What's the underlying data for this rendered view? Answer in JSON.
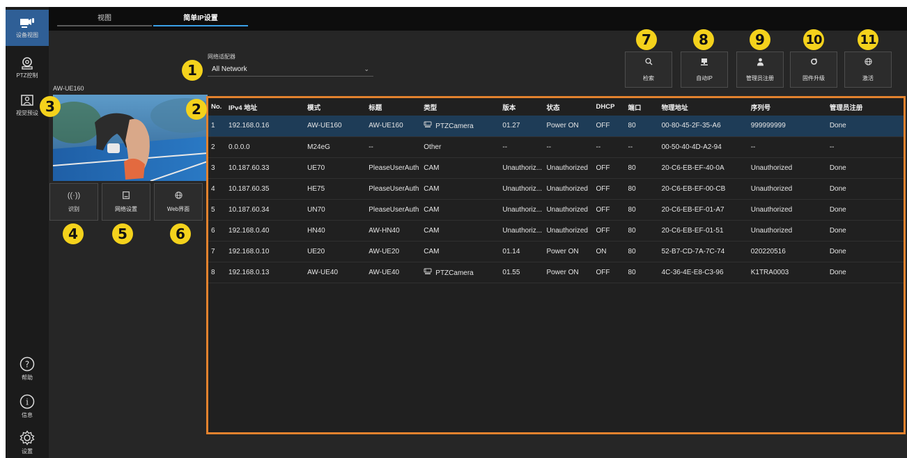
{
  "nav": {
    "items": [
      {
        "label": "设备视图",
        "icon": "camera-mic-icon"
      },
      {
        "label": "PTZ控制",
        "icon": "ptz-camera-icon"
      },
      {
        "label": "视觉预设",
        "icon": "person-frame-icon"
      },
      {
        "label": "帮助",
        "icon": "question-icon"
      },
      {
        "label": "信息",
        "icon": "info-icon"
      },
      {
        "label": "设置",
        "icon": "gear-icon"
      }
    ]
  },
  "tabs": [
    {
      "label": "视图",
      "active": false
    },
    {
      "label": "简单IP设置",
      "active": true
    }
  ],
  "adapter": {
    "label": "网络适配器",
    "value": "All Network"
  },
  "camera": {
    "name": "AW-UE160"
  },
  "camera_buttons": [
    {
      "label": "识别",
      "icon": "signal-icon"
    },
    {
      "label": "网络设置",
      "icon": "network-settings-icon"
    },
    {
      "label": "Web界面",
      "icon": "globe-icon"
    }
  ],
  "toolbar": [
    {
      "label": "检索",
      "icon": "search-icon"
    },
    {
      "label": "自动IP",
      "icon": "network-device-icon"
    },
    {
      "label": "管理员注册",
      "icon": "user-icon"
    },
    {
      "label": "固件升级",
      "icon": "refresh-icon"
    },
    {
      "label": "激活",
      "icon": "globe-icon"
    }
  ],
  "callouts": [
    "1",
    "2",
    "3",
    "4",
    "5",
    "6",
    "7",
    "8",
    "9",
    "10",
    "11"
  ],
  "table": {
    "headers": [
      "No.",
      "IPv4 地址",
      "模式",
      "标题",
      "类型",
      "版本",
      "状态",
      "DHCP",
      "端口",
      "物理地址",
      "序列号",
      "管理员注册"
    ],
    "rows": [
      [
        "1",
        "192.168.0.16",
        "AW-UE160",
        "AW-UE160",
        "PTZCamera",
        "01.27",
        "Power ON",
        "OFF",
        "80",
        "00-80-45-2F-35-A6",
        "999999999",
        "Done"
      ],
      [
        "2",
        "0.0.0.0",
        "M24eG",
        "--",
        "Other",
        "--",
        "--",
        "--",
        "--",
        "00-50-40-4D-A2-94",
        "--",
        "--"
      ],
      [
        "3",
        "10.187.60.33",
        "UE70",
        "PleaseUserAuth",
        "CAM",
        "Unauthoriz...",
        "Unauthorized",
        "OFF",
        "80",
        "20-C6-EB-EF-40-0A",
        "Unauthorized",
        "Done"
      ],
      [
        "4",
        "10.187.60.35",
        "HE75",
        "PleaseUserAuth",
        "CAM",
        "Unauthoriz...",
        "Unauthorized",
        "OFF",
        "80",
        "20-C6-EB-EF-00-CB",
        "Unauthorized",
        "Done"
      ],
      [
        "5",
        "10.187.60.34",
        "UN70",
        "PleaseUserAuth",
        "CAM",
        "Unauthoriz...",
        "Unauthorized",
        "OFF",
        "80",
        "20-C6-EB-EF-01-A7",
        "Unauthorized",
        "Done"
      ],
      [
        "6",
        "192.168.0.40",
        "HN40",
        "AW-HN40",
        "CAM",
        "Unauthoriz...",
        "Unauthorized",
        "OFF",
        "80",
        "20-C6-EB-EF-01-51",
        "Unauthorized",
        "Done"
      ],
      [
        "7",
        "192.168.0.10",
        "UE20",
        "AW-UE20",
        "CAM",
        "01.14",
        "Power ON",
        "ON",
        "80",
        "52-B7-CD-7A-7C-74",
        "020220516",
        "Done"
      ],
      [
        "8",
        "192.168.0.13",
        "AW-UE40",
        "AW-UE40",
        "PTZCamera",
        "01.55",
        "Power ON",
        "OFF",
        "80",
        "4C-36-4E-E8-C3-96",
        "K1TRA0003",
        "Done"
      ]
    ],
    "selected_row": 0,
    "ptz_icon": "ptz-camera-icon"
  },
  "colors": {
    "accent": "#2f5f96",
    "highlight_border": "#e2822e",
    "callout": "#f4d21c",
    "tab_underline": "#3aa0e8",
    "selected_row": "#1e3c57"
  }
}
